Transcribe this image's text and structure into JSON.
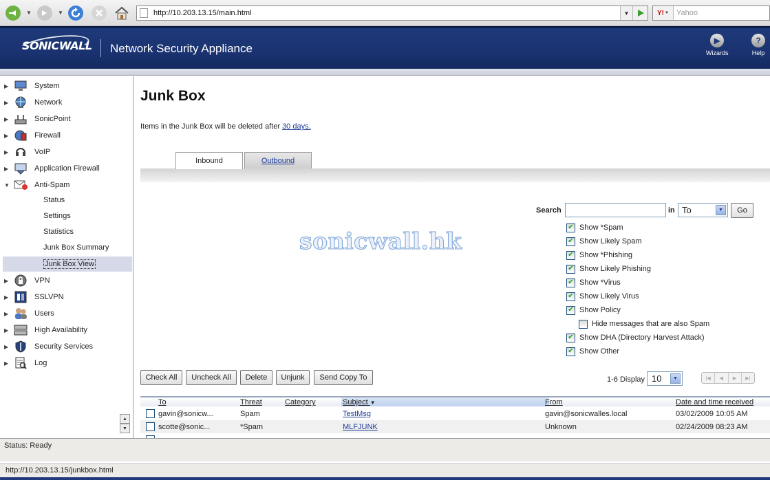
{
  "browser": {
    "url": "http://10.203.13.15/main.html",
    "search_placeholder": "Yahoo",
    "search_brand": "Y!",
    "status_url": "http://10.203.13.15/junkbox.html"
  },
  "header": {
    "logo": "SONICWALL",
    "product": "Network Security Appliance",
    "wizards_label": "Wizards",
    "help_label": "Help"
  },
  "sidebar": {
    "items": [
      {
        "label": "System",
        "icon": "monitor-icon"
      },
      {
        "label": "Network",
        "icon": "globe-icon"
      },
      {
        "label": "SonicPoint",
        "icon": "access-point-icon"
      },
      {
        "label": "Firewall",
        "icon": "firewall-icon"
      },
      {
        "label": "VoIP",
        "icon": "headset-icon"
      },
      {
        "label": "Application Firewall",
        "icon": "app-firewall-icon"
      },
      {
        "label": "Anti-Spam",
        "icon": "envelope-icon",
        "expanded": true
      },
      {
        "label": "VPN",
        "icon": "lock-icon"
      },
      {
        "label": "SSLVPN",
        "icon": "sslvpn-icon"
      },
      {
        "label": "Users",
        "icon": "users-icon"
      },
      {
        "label": "High Availability",
        "icon": "servers-icon"
      },
      {
        "label": "Security Services",
        "icon": "shield-icon"
      },
      {
        "label": "Log",
        "icon": "log-icon"
      }
    ],
    "antispam_sub": [
      "Status",
      "Settings",
      "Statistics",
      "Junk Box Summary",
      "Junk Box View"
    ],
    "selected": "Junk Box View"
  },
  "main": {
    "title": "Junk Box",
    "info_prefix": "Items in the Junk Box will be deleted after ",
    "info_link": "30 days.",
    "tabs": [
      "Inbound",
      "Outbound"
    ],
    "active_tab": "Inbound",
    "search_label": "Search",
    "search_value": "",
    "in_label": "in",
    "search_field": "To",
    "go_label": "Go",
    "filters": [
      {
        "label": "Show *Spam",
        "checked": true
      },
      {
        "label": "Show Likely Spam",
        "checked": true
      },
      {
        "label": "Show *Phishing",
        "checked": true
      },
      {
        "label": "Show Likely Phishing",
        "checked": true
      },
      {
        "label": "Show *Virus",
        "checked": true
      },
      {
        "label": "Show Likely Virus",
        "checked": true
      },
      {
        "label": "Show Policy",
        "checked": true
      },
      {
        "label": "Hide messages that are also Spam",
        "checked": false
      },
      {
        "label": "Show DHA (Directory Harvest Attack)",
        "checked": true
      },
      {
        "label": "Show Other",
        "checked": true
      }
    ],
    "watermark": "sonicwall.hk",
    "actions": [
      "Check All",
      "Uncheck All",
      "Delete",
      "Unjunk",
      "Send Copy To"
    ],
    "display_label": "1-6 Display",
    "page_size": "10",
    "columns": [
      "To",
      "Threat",
      "Category",
      "Subject",
      "From",
      "Date and time received"
    ],
    "rows": [
      {
        "to": "gavin@sonicw...",
        "threat": "Spam",
        "category": "",
        "subject": "TestMsg",
        "from": "gavin@sonicwalles.local",
        "date": "03/02/2009 10:05 AM"
      },
      {
        "to": "scotte@sonic...",
        "threat": "*Spam",
        "category": "",
        "subject": "MLFJUNK",
        "from": "Unknown",
        "date": "02/24/2009 08:23 AM"
      }
    ]
  },
  "status": {
    "app": "Status: Ready"
  },
  "colors": {
    "header_blue": "#1f3a7a",
    "link_blue": "#1a3a9a",
    "selected_bg": "#d6d9e8"
  }
}
